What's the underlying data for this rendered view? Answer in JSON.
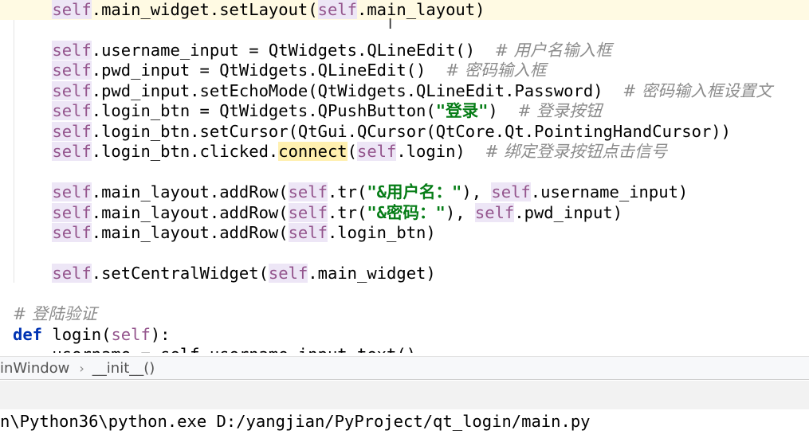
{
  "editor": {
    "lines": [
      {
        "indent": "    ",
        "segs": [
          [
            "self",
            "self"
          ],
          [
            "",
            ".main_widget.setLayout("
          ],
          [
            "self",
            "self"
          ],
          [
            "",
            ".main_layout)"
          ]
        ],
        "current": true
      },
      {
        "indent": "",
        "segs": []
      },
      {
        "indent": "    ",
        "segs": [
          [
            "self",
            "self"
          ],
          [
            "",
            ".username_input = QtWidgets.QLineEdit()  "
          ],
          [
            "cm",
            "# 用户名输入框"
          ]
        ]
      },
      {
        "indent": "    ",
        "segs": [
          [
            "self",
            "self"
          ],
          [
            "",
            ".pwd_input = QtWidgets.QLineEdit()  "
          ],
          [
            "cm",
            "# 密码输入框"
          ]
        ]
      },
      {
        "indent": "    ",
        "segs": [
          [
            "self",
            "self"
          ],
          [
            "",
            ".pwd_input.setEchoMode(QtWidgets.QLineEdit.Password)  "
          ],
          [
            "cm",
            "# 密码输入框设置文"
          ]
        ]
      },
      {
        "indent": "    ",
        "segs": [
          [
            "self",
            "self"
          ],
          [
            "",
            ".login_btn = QtWidgets.QPushButton("
          ],
          [
            "str",
            "\"登录\""
          ],
          [
            "",
            ")  "
          ],
          [
            "cm",
            "# 登录按钮"
          ]
        ]
      },
      {
        "indent": "    ",
        "segs": [
          [
            "self",
            "self"
          ],
          [
            "",
            ".login_btn.setCursor(QtGui.QCursor(QtCore.Qt.PointingHandCursor))"
          ]
        ]
      },
      {
        "indent": "    ",
        "segs": [
          [
            "self",
            "self"
          ],
          [
            "",
            ".login_btn.clicked."
          ],
          [
            "hl",
            "connect"
          ],
          [
            "",
            "("
          ],
          [
            "self",
            "self"
          ],
          [
            "",
            ".login)  "
          ],
          [
            "cm",
            "# 绑定登录按钮点击信号"
          ]
        ]
      },
      {
        "indent": "",
        "segs": []
      },
      {
        "indent": "    ",
        "segs": [
          [
            "self",
            "self"
          ],
          [
            "",
            ".main_layout.addRow("
          ],
          [
            "self",
            "self"
          ],
          [
            "",
            ".tr("
          ],
          [
            "str",
            "\"&用户名：\""
          ],
          [
            "",
            "), "
          ],
          [
            "self",
            "self"
          ],
          [
            "",
            ".username_input)"
          ]
        ]
      },
      {
        "indent": "    ",
        "segs": [
          [
            "self",
            "self"
          ],
          [
            "",
            ".main_layout.addRow("
          ],
          [
            "self",
            "self"
          ],
          [
            "",
            ".tr("
          ],
          [
            "str",
            "\"&密码：\""
          ],
          [
            "",
            "), "
          ],
          [
            "self",
            "self"
          ],
          [
            "",
            ".pwd_input)"
          ]
        ]
      },
      {
        "indent": "    ",
        "segs": [
          [
            "self",
            "self"
          ],
          [
            "",
            ".main_layout.addRow("
          ],
          [
            "self",
            "self"
          ],
          [
            "",
            ".login_btn)"
          ]
        ]
      },
      {
        "indent": "",
        "segs": []
      },
      {
        "indent": "    ",
        "segs": [
          [
            "self",
            "self"
          ],
          [
            "",
            ".setCentralWidget("
          ],
          [
            "self",
            "self"
          ],
          [
            "",
            ".main_widget)"
          ]
        ]
      },
      {
        "indent": "",
        "segs": []
      },
      {
        "indent": "",
        "segs": [
          [
            "cm",
            "# 登陆验证"
          ]
        ]
      },
      {
        "indent": "",
        "segs": [
          [
            "kw",
            "def"
          ],
          [
            "",
            " login("
          ],
          [
            "selfplain",
            "self"
          ],
          [
            "",
            "):"
          ]
        ]
      },
      {
        "indent": "    ",
        "segs": [
          [
            "cut",
            "username = self.username_input.text()"
          ]
        ]
      }
    ]
  },
  "breadcrumb": {
    "class_name": "inWindow",
    "separator": "›",
    "method_name": "__init__()"
  },
  "console": {
    "line": "n\\Python36\\python.exe D:/yangjian/PyProject/qt_login/main.py"
  },
  "colors": {
    "self_keyword": "#94558d",
    "string": "#067d17",
    "comment": "#8c8c8c",
    "keyword": "#0033b3",
    "current_line": "#fffae3"
  },
  "icons": {
    "text_cursor": "i-beam-cursor-icon"
  }
}
